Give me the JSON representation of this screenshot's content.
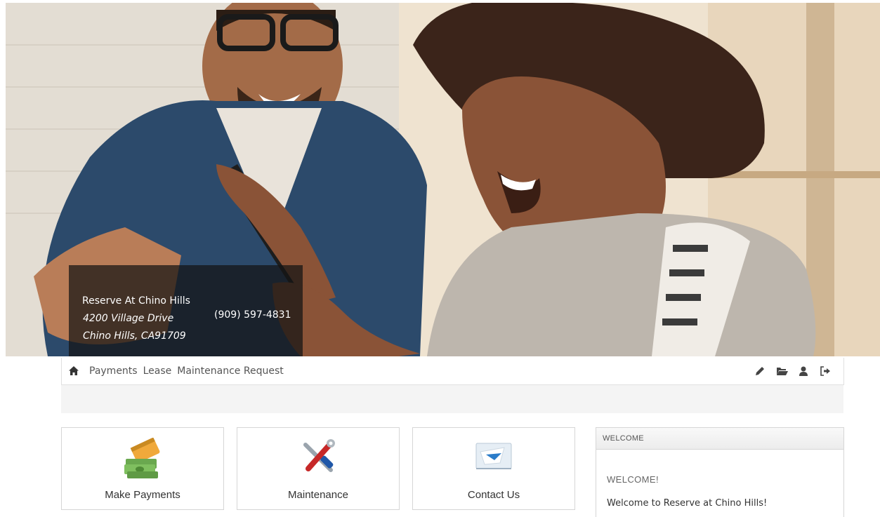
{
  "property": {
    "name": "Reserve At Chino Hills",
    "address_line1": "4200 Village Drive",
    "address_line2": "Chino Hills, CA91709",
    "phone": "(909) 597-4831"
  },
  "nav": {
    "home_icon": "home-icon",
    "links": [
      "Payments",
      "Lease",
      "Maintenance Request"
    ],
    "right_icons": [
      "pencil-icon",
      "folder-open-icon",
      "user-icon",
      "sign-out-icon"
    ]
  },
  "cards": [
    {
      "label": "Make Payments",
      "icon": "credit-card-money-icon"
    },
    {
      "label": "Maintenance",
      "icon": "wrench-screwdriver-icon"
    },
    {
      "label": "Contact Us",
      "icon": "envelope-icon"
    }
  ],
  "welcome_panel": {
    "header": "WELCOME",
    "title": "WELCOME!",
    "text": "Welcome to Reserve at Chino Hills!"
  },
  "colors": {
    "nav_text": "#555555",
    "subbar_bg": "#f4f4f4",
    "info_box_bg": "rgba(20,20,20,0.72)"
  }
}
